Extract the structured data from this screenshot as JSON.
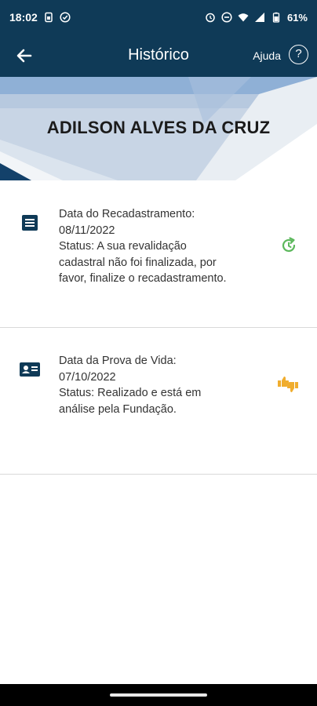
{
  "status_bar": {
    "time": "18:02",
    "battery": "61%"
  },
  "app_bar": {
    "title": "Histórico",
    "help_label": "Ajuda",
    "help_icon_glyph": "?"
  },
  "banner": {
    "name": "ADILSON ALVES DA CRUZ"
  },
  "history": [
    {
      "icon": "document-list-icon",
      "lines": [
        "Data do Recadastramento:",
        "08/11/2022",
        "Status: A sua revalidação",
        "cadastral não foi finalizada, por",
        "favor, finalize o recadastramento."
      ],
      "status_icon": "pending-refresh-icon",
      "status_color": "#5cb85c"
    },
    {
      "icon": "id-card-icon",
      "lines": [
        "Data da Prova de Vida:",
        "07/10/2022",
        "Status: Realizado e está em",
        "análise pela Fundação."
      ],
      "status_icon": "thumbs-up-down-icon",
      "status_color": "#f0ad2e"
    }
  ],
  "colors": {
    "primary": "#0f3a57",
    "divider": "#d9d9d9"
  }
}
